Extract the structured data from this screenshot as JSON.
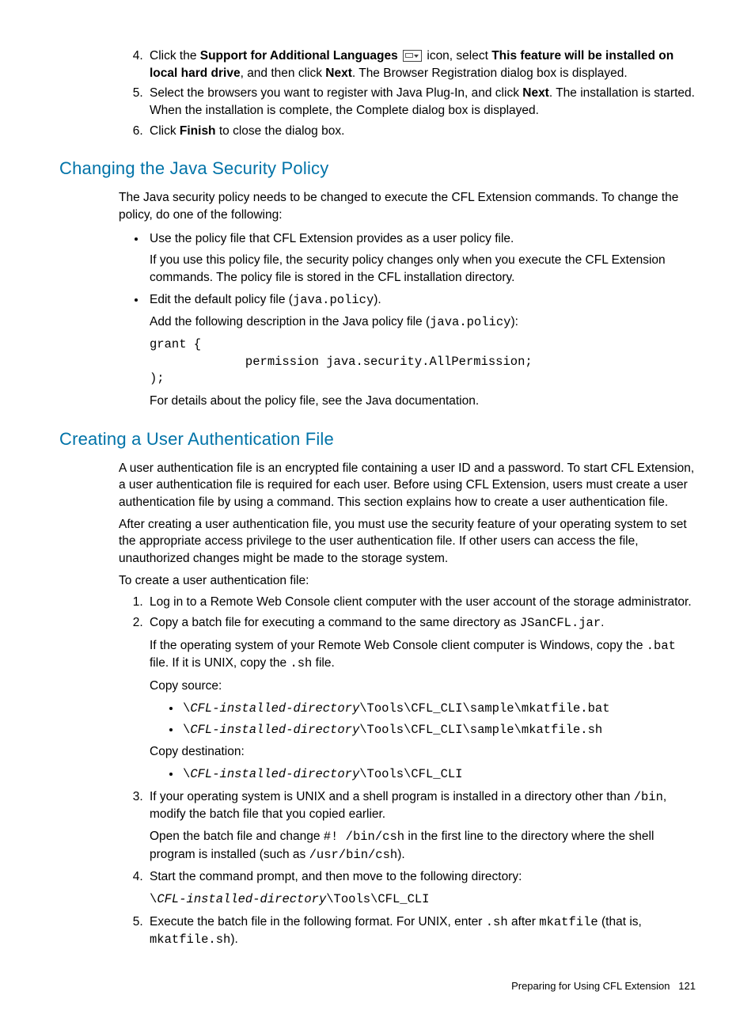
{
  "topList": {
    "item4": {
      "pre": "Click the ",
      "b1": "Support for Additional Languages",
      "mid1": " icon, select ",
      "b2": "This feature will be installed on local hard drive",
      "mid2": ", and then click ",
      "b3": "Next",
      "post": ". The Browser Registration dialog box is displayed."
    },
    "item5": {
      "pre": "Select the browsers you want to register with Java Plug-In, and click ",
      "b1": "Next",
      "post": ". The installation is started. When the installation is complete, the Complete dialog box is displayed."
    },
    "item6": {
      "pre": "Click ",
      "b1": "Finish",
      "post": " to close the dialog box."
    }
  },
  "sectionA": {
    "title": "Changing the Java Security Policy",
    "intro": "The Java security policy needs to be changed to execute the CFL Extension commands. To change the policy, do one of the following:",
    "bullet1": {
      "line1": "Use the policy file that CFL Extension provides as a user policy file.",
      "line2": "If you use this policy file, the security policy changes only when you execute the CFL Extension commands. The policy file is stored in the CFL installation directory."
    },
    "bullet2": {
      "pre": "Edit the default policy file (",
      "code1": "java.policy",
      "post": ").",
      "line2pre": "Add the following description in the Java policy file (",
      "line2code": "java.policy",
      "line2post": "):",
      "codeblock": "grant {\n             permission java.security.AllPermission;\n);",
      "line3": "For details about the policy file, see the Java documentation."
    }
  },
  "sectionB": {
    "title": "Creating a User Authentication File",
    "para1": "A user authentication file is an encrypted file containing a user ID and a password. To start CFL Extension, a user authentication file is required for each user. Before using CFL Extension, users must create a user authentication file by using a command. This section explains how to create a user authentication file.",
    "para2": "After creating a user authentication file, you must use the security feature of your operating system to set the appropriate access privilege to the user authentication file. If other users can access the file, unauthorized changes might be made to the storage system.",
    "para3": "To create a user authentication file:",
    "step1": "Log in to a Remote Web Console client computer with the user account of the storage administrator.",
    "step2": {
      "pre": "Copy a batch file for executing a command to the same directory as ",
      "code1": "JSanCFL.jar",
      "post": ".",
      "line2a": "If the operating system of your Remote Web Console client computer is Windows, copy the ",
      "line2code1": ".bat",
      "line2b": " file. If it is UNIX, copy the ",
      "line2code2": ".sh",
      "line2c": " file.",
      "copySrc": "Copy source:",
      "srcItem1a": "CFL-installed-directory",
      "srcItem1b": "\\Tools\\CFL_CLI\\sample\\mkatfile.bat",
      "srcItem2a": "CFL-installed-directory",
      "srcItem2b": "\\Tools\\CFL_CLI\\sample\\mkatfile.sh",
      "copyDst": "Copy destination:",
      "dstItem1a": "CFL-installed-directory",
      "dstItem1b": "\\Tools\\CFL_CLI"
    },
    "step3": {
      "line1a": "If your operating system is UNIX and a shell program is installed in a directory other than ",
      "line1code": "/bin",
      "line1b": ", modify the batch file that you copied earlier.",
      "line2a": "Open the batch file and change ",
      "line2code1": "#! /bin/csh",
      "line2b": " in the first line to the directory where the shell program is installed (such as ",
      "line2code2": "/usr/bin/csh",
      "line2c": ")."
    },
    "step4": {
      "line1": "Start the command prompt, and then move to the following directory:",
      "codeA": "CFL-installed-directory",
      "codeB": "\\Tools\\CFL_CLI"
    },
    "step5": {
      "a": "Execute the batch file in the following format. For UNIX, enter ",
      "code1": ".sh",
      "b": " after ",
      "code2": "mkatfile",
      "c": " (that is, ",
      "code3": "mkatfile.sh",
      "d": ")."
    }
  },
  "footer": {
    "text": "Preparing for Using CFL Extension",
    "page": "121"
  },
  "backslash": "\\"
}
